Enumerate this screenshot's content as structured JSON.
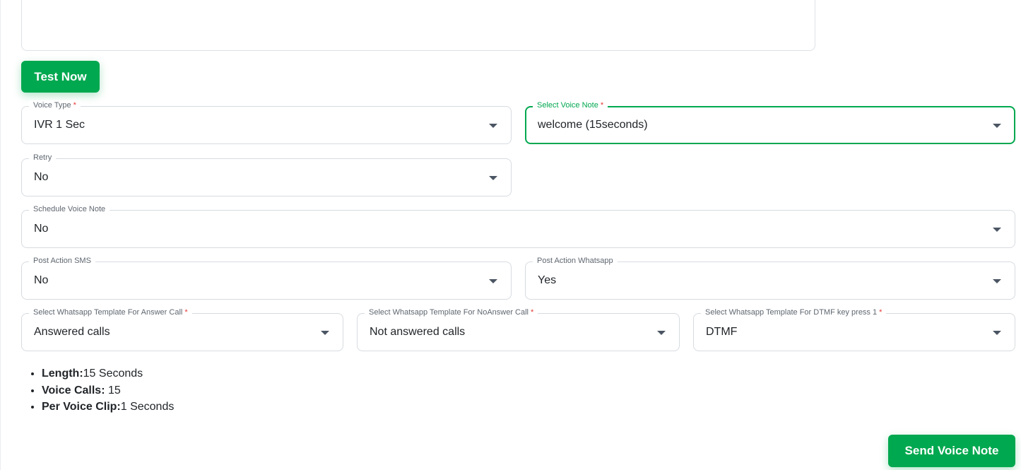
{
  "test_button_label": "Test Now",
  "send_button_label": "Send Voice Note",
  "fields": {
    "voice_type": {
      "label": "Voice Type",
      "value": "IVR 1 Sec",
      "required_mark": "*"
    },
    "voice_note": {
      "label": "Select Voice Note",
      "value": "welcome (15seconds)",
      "required_mark": "*"
    },
    "retry": {
      "label": "Retry",
      "value": "No"
    },
    "schedule": {
      "label": "Schedule Voice Note",
      "value": "No"
    },
    "post_sms": {
      "label": "Post Action SMS",
      "value": "No"
    },
    "post_whatsapp": {
      "label": "Post Action Whatsapp",
      "value": "Yes"
    },
    "tpl_answer": {
      "label": "Select Whatsapp Template For Answer Call",
      "value": "Answered calls",
      "required_mark": "*"
    },
    "tpl_noanswer": {
      "label": "Select Whatsapp Template For NoAnswer Call",
      "value": "Not answered calls",
      "required_mark": "*"
    },
    "tpl_dtmf": {
      "label": "Select Whatsapp Template For DTMF key press 1",
      "value": "DTMF",
      "required_mark": "*"
    }
  },
  "info": {
    "length_label": "Length:",
    "length_value": "15 Seconds",
    "calls_label": "Voice Calls:",
    "calls_value": " 15",
    "clip_label": "Per Voice Clip:",
    "clip_value": "1 Seconds"
  },
  "colors": {
    "accent": "#00a84f",
    "required": "#e53935",
    "border": "#d7dbe0"
  }
}
